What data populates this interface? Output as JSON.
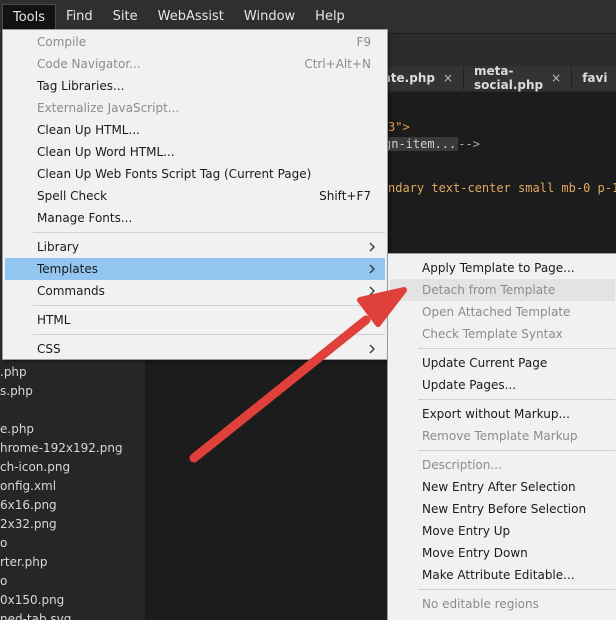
{
  "menubar": {
    "items": [
      "Tools",
      "Find",
      "Site",
      "WebAssist",
      "Window",
      "Help"
    ]
  },
  "tabs": [
    {
      "label": "plate.php"
    },
    {
      "label": "meta-social.php"
    },
    {
      "label": "favi"
    }
  ],
  "editor": {
    "line1": "3\">",
    "line2_fold": "gn-item...",
    "line2_end": "-->",
    "line3": "ndary text-center small mb-0 p-1"
  },
  "files": [
    ".php",
    "s.php",
    "",
    "e.php",
    "hrome-192x192.png",
    "ch-icon.png",
    "onfig.xml",
    "6x16.png",
    "2x32.png",
    "o",
    "rter.php",
    "o",
    "0x150.png",
    "ned-tab.svg"
  ],
  "tools_menu": {
    "items": [
      {
        "label": "Compile",
        "shortcut": "F9",
        "disabled": true
      },
      {
        "label": "Code Navigator...",
        "shortcut": "Ctrl+Alt+N",
        "disabled": true
      },
      {
        "label": "Tag Libraries..."
      },
      {
        "label": "Externalize JavaScript...",
        "disabled": true
      },
      {
        "label": "Clean Up HTML..."
      },
      {
        "label": "Clean Up Word HTML..."
      },
      {
        "label": "Clean Up Web Fonts Script Tag (Current Page)"
      },
      {
        "label": "Spell Check",
        "shortcut": "Shift+F7"
      },
      {
        "label": "Manage Fonts..."
      },
      {
        "label": "Library",
        "submenu": true
      },
      {
        "label": "Templates",
        "submenu": true,
        "highlighted": true
      },
      {
        "label": "Commands",
        "submenu": true
      },
      {
        "label": "HTML"
      },
      {
        "label": "CSS",
        "submenu": true
      }
    ]
  },
  "templates_submenu": {
    "items": [
      {
        "label": "Apply Template to Page..."
      },
      {
        "label": "Detach from Template",
        "disabled": true,
        "hover": true
      },
      {
        "label": "Open Attached Template",
        "disabled": true
      },
      {
        "label": "Check Template Syntax",
        "disabled": true
      },
      {
        "label": "Update Current Page"
      },
      {
        "label": "Update Pages..."
      },
      {
        "label": "Export without Markup..."
      },
      {
        "label": "Remove Template Markup",
        "disabled": true
      },
      {
        "label": "Description...",
        "disabled": true
      },
      {
        "label": "New Entry After Selection"
      },
      {
        "label": "New Entry Before Selection"
      },
      {
        "label": "Move Entry Up"
      },
      {
        "label": "Move Entry Down"
      },
      {
        "label": "Make Attribute Editable..."
      },
      {
        "label": "No editable regions",
        "disabled": true
      }
    ]
  },
  "colors": {
    "highlight": "#92c6f1",
    "arrow": "#e0403a"
  }
}
